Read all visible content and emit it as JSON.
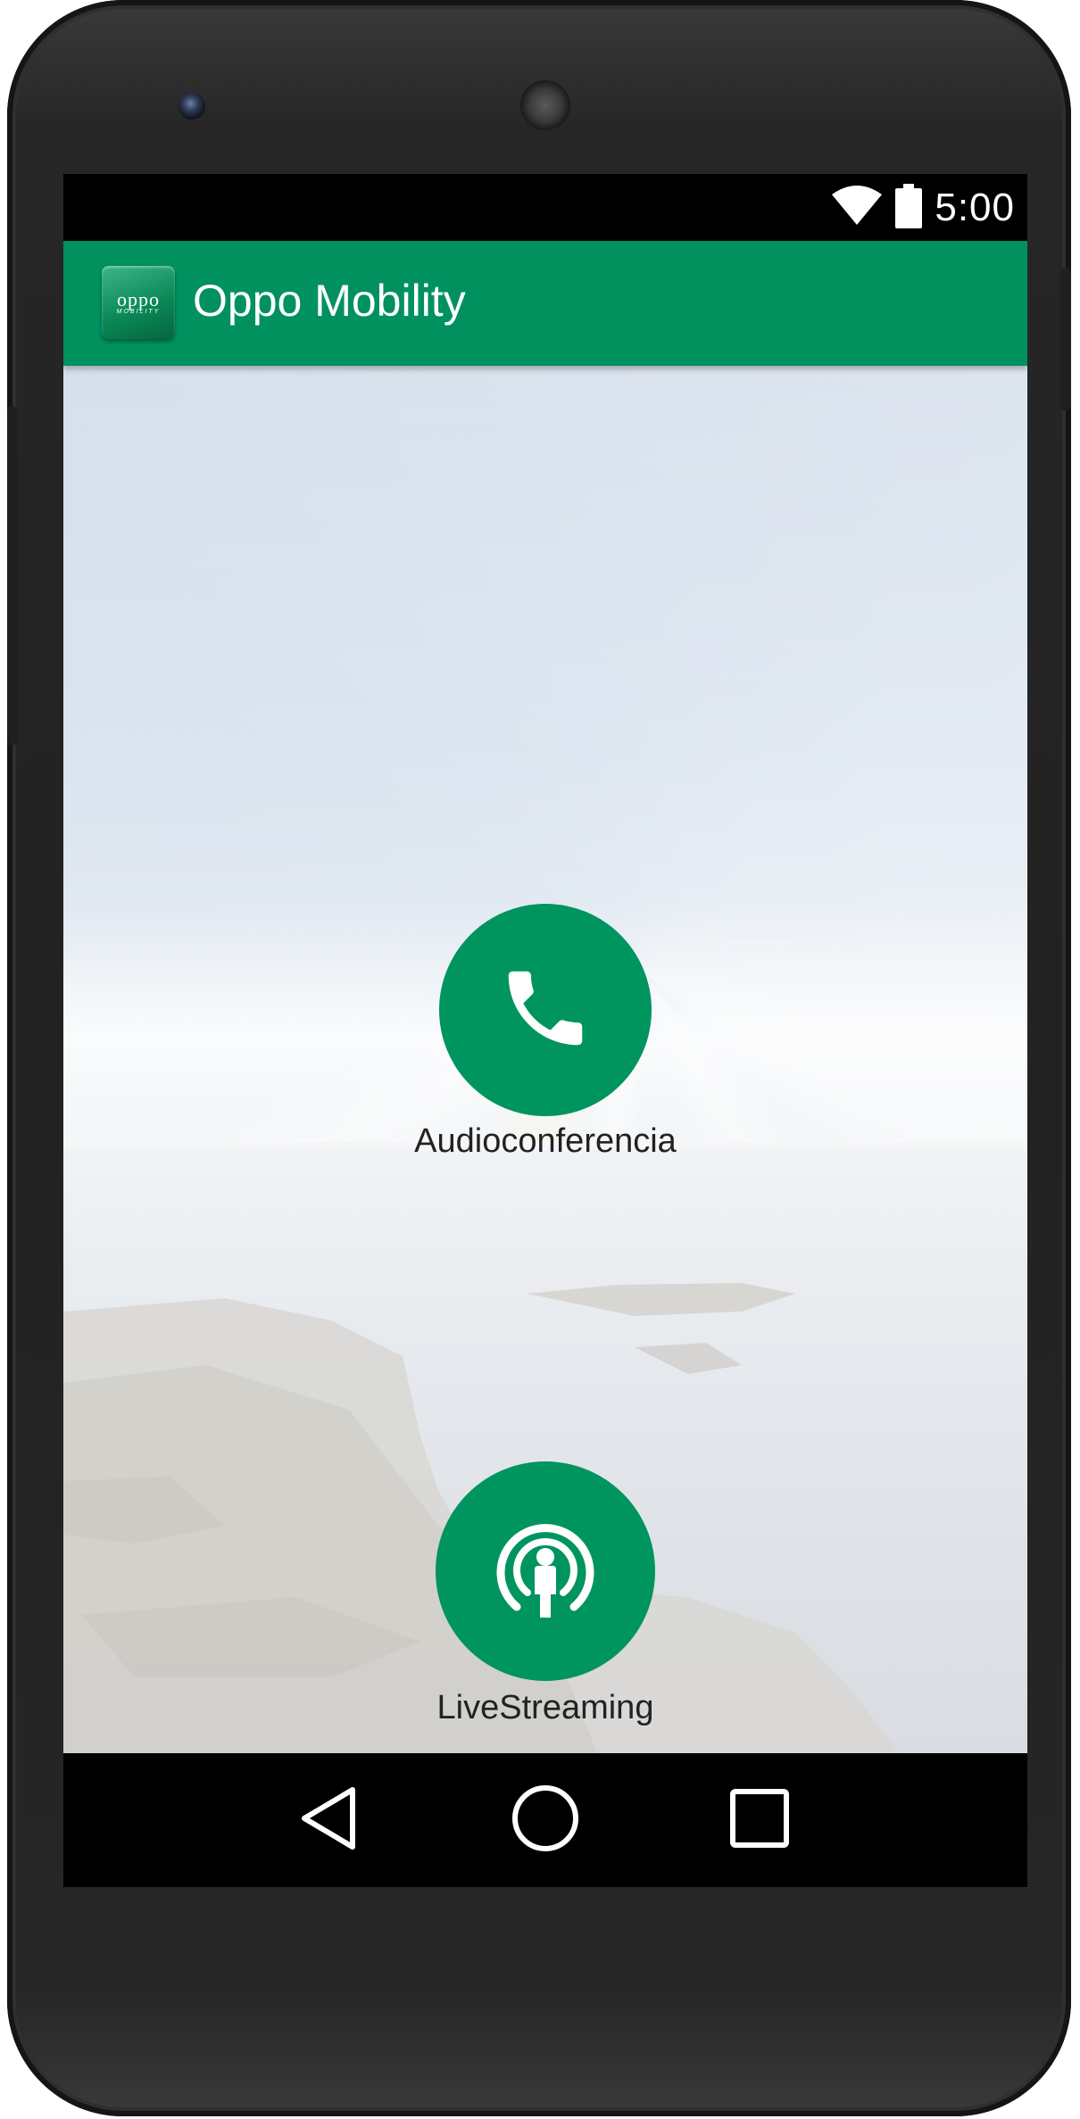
{
  "status_bar": {
    "time": "5:00",
    "wifi_icon": "wifi-full-icon",
    "battery_icon": "battery-full-icon"
  },
  "app_bar": {
    "logo_brand": "oppo",
    "logo_sub": "MOBILITY",
    "title": "Oppo Mobility",
    "color": "#00915f"
  },
  "actions": [
    {
      "label": "Audioconferencia",
      "icon": "phone-icon"
    },
    {
      "label": "LiveStreaming",
      "icon": "podcast-person-icon"
    }
  ],
  "nav_bar": {
    "back_icon": "back-triangle-icon",
    "home_icon": "home-circle-icon",
    "recent_icon": "recent-apps-square-icon"
  },
  "colors": {
    "accent": "#00945f",
    "status_bar_bg": "#000000",
    "label_text": "#222222"
  }
}
